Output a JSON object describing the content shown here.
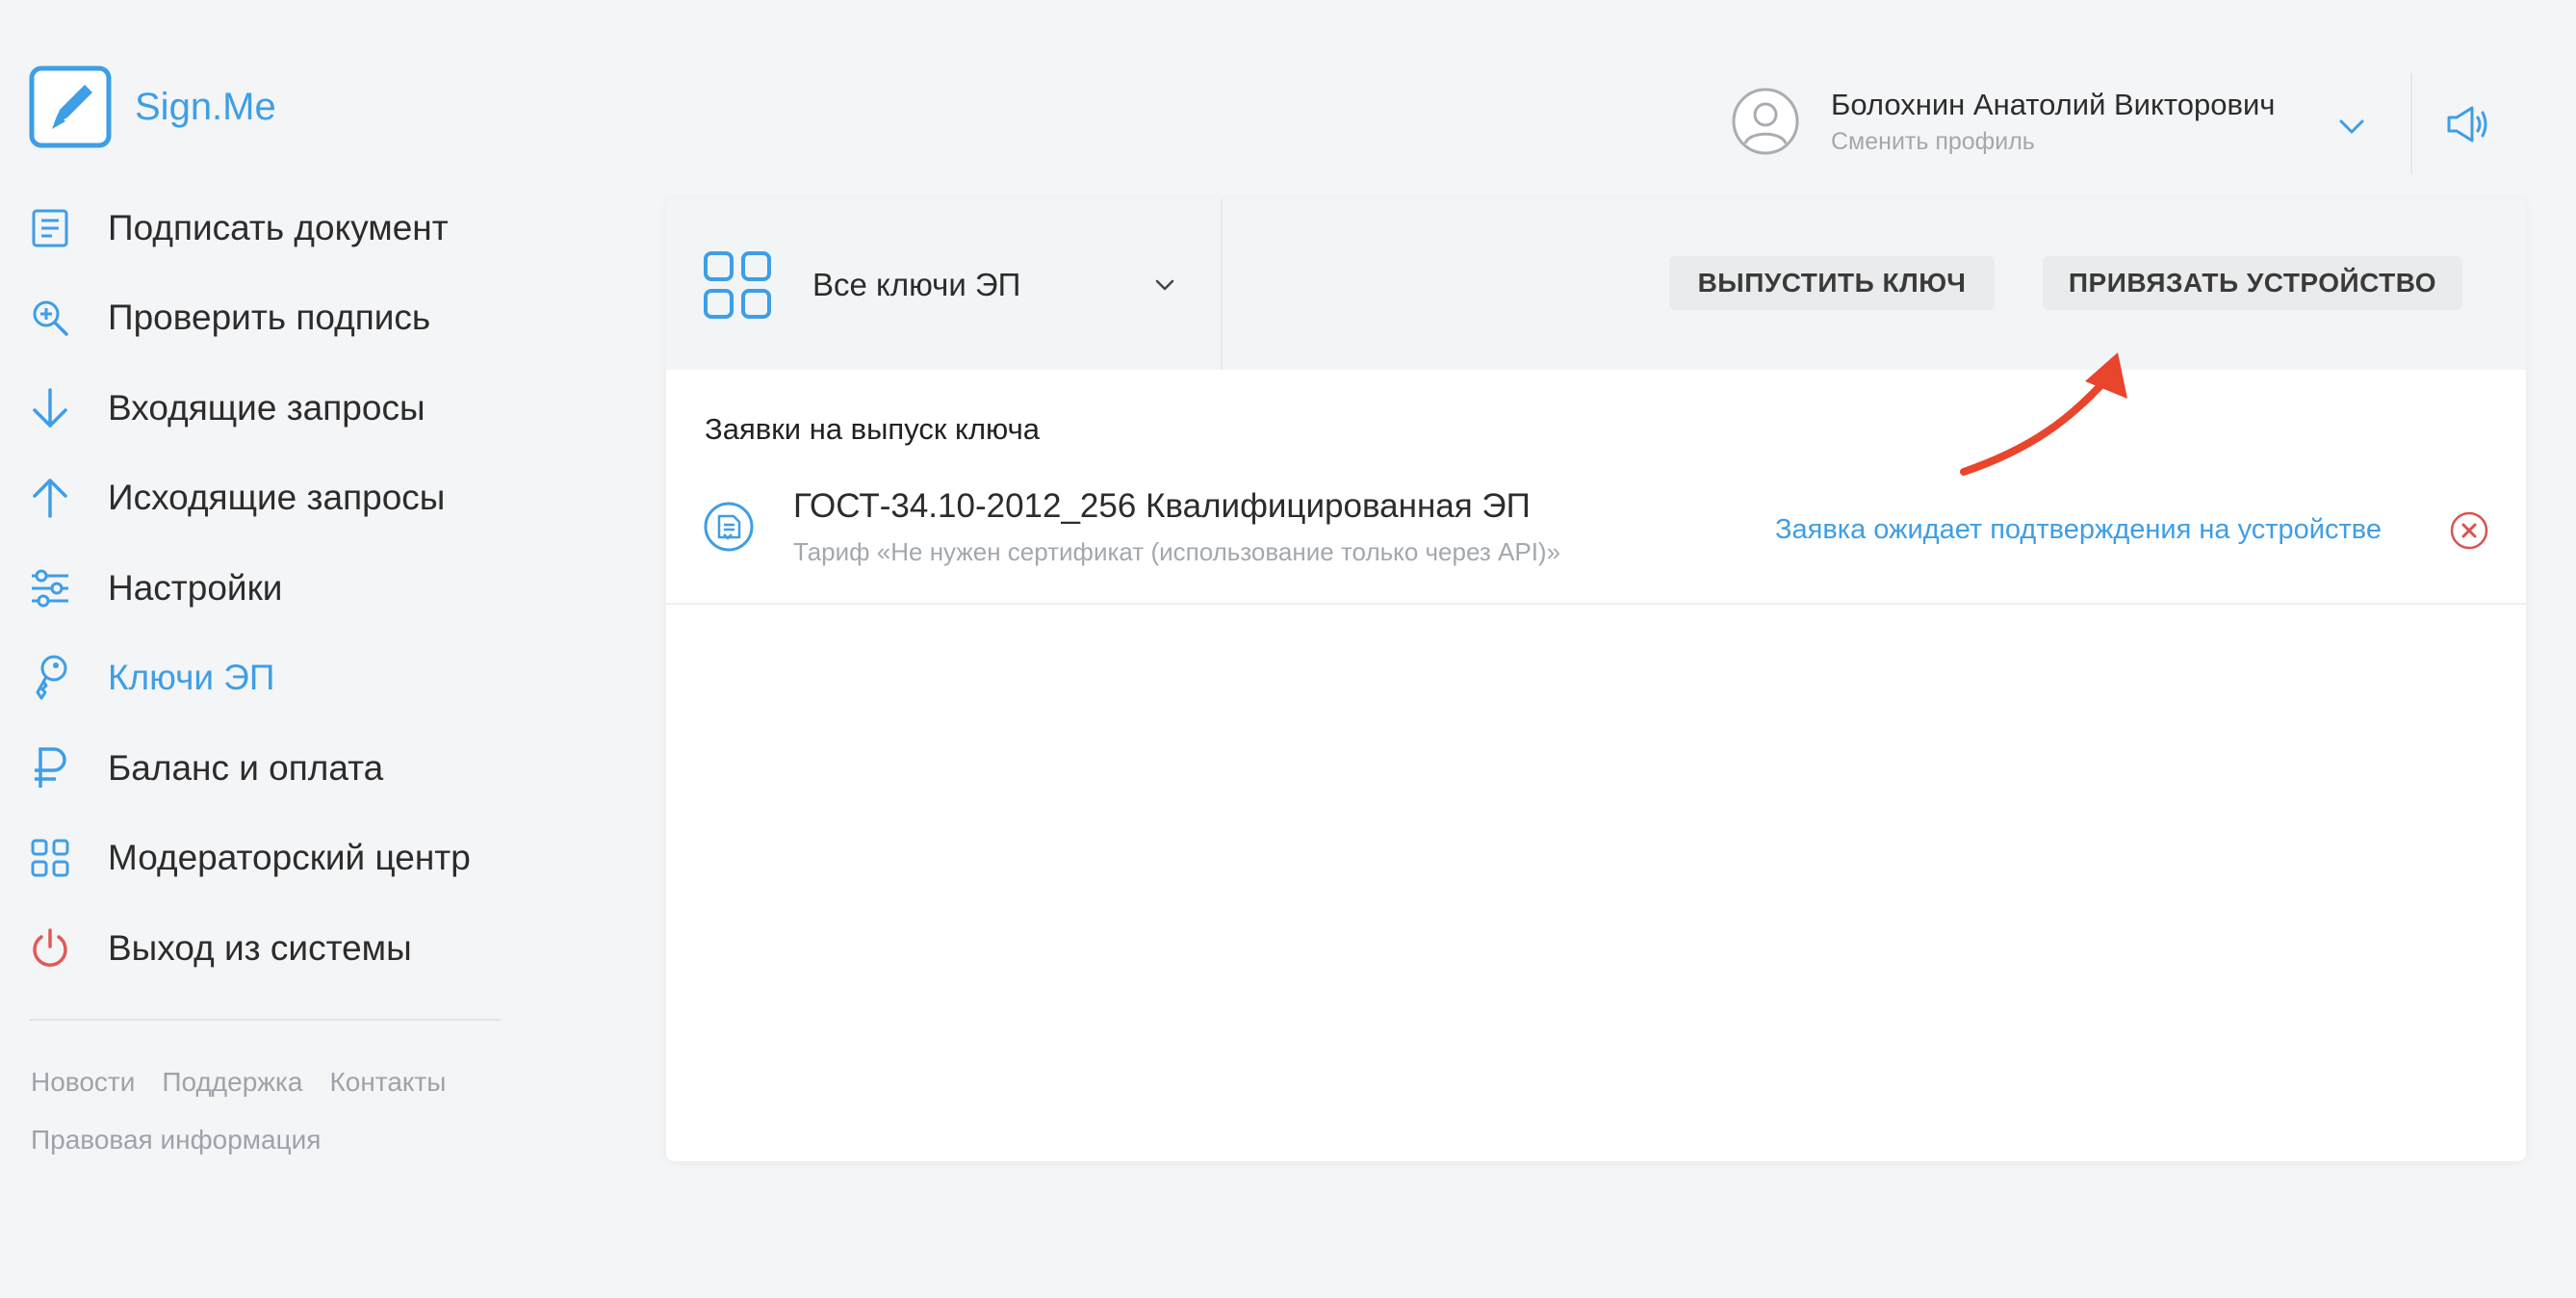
{
  "app": {
    "name": "Sign.Me",
    "brand_color": "#3e9ee6",
    "logo_icon": "pen-in-square-icon"
  },
  "sidebar": {
    "items": [
      {
        "label": "Подписать документ",
        "icon": "document-icon",
        "active": false
      },
      {
        "label": "Проверить подпись",
        "icon": "search-plus-icon",
        "active": false
      },
      {
        "label": "Входящие запросы",
        "icon": "arrow-down-icon",
        "active": false
      },
      {
        "label": "Исходящие запросы",
        "icon": "arrow-up-icon",
        "active": false
      },
      {
        "label": "Настройки",
        "icon": "sliders-icon",
        "active": false
      },
      {
        "label": "Ключи ЭП",
        "icon": "key-icon",
        "active": true
      },
      {
        "label": "Баланс и оплата",
        "icon": "ruble-icon",
        "active": false
      },
      {
        "label": "Модераторский центр",
        "icon": "grid-icon",
        "active": false
      },
      {
        "label": "Выход из системы",
        "icon": "power-icon",
        "active": false
      }
    ],
    "footer": {
      "news": "Новости",
      "support": "Поддержка",
      "contacts": "Контакты",
      "legal": "Правовая информация"
    }
  },
  "header": {
    "user_name": "Болохнин Анатолий Викторович",
    "switch_profile": "Сменить профиль",
    "avatar_icon": "user-avatar-icon",
    "notifications_icon": "megaphone-icon"
  },
  "toolbar": {
    "selector_label": "Все ключи ЭП",
    "issue_key_button": "ВЫПУСТИТЬ КЛЮЧ",
    "bind_device_button": "ПРИВЯЗАТЬ УСТРОЙСТВО"
  },
  "requests": {
    "section_title": "Заявки на выпуск ключа",
    "items": [
      {
        "title": "ГОСТ-34.10-2012_256 Квалифицированная ЭП",
        "subtitle": "Тариф «Не нужен сертификат (использование только через API)»",
        "status": "Заявка ожидает подтверждения на устройстве",
        "status_color": "#3e9ee6",
        "cancel_icon": "close-circle-icon",
        "cancel_color": "#d9534f"
      }
    ]
  },
  "annotation": {
    "arrow_color": "#e8452c"
  }
}
